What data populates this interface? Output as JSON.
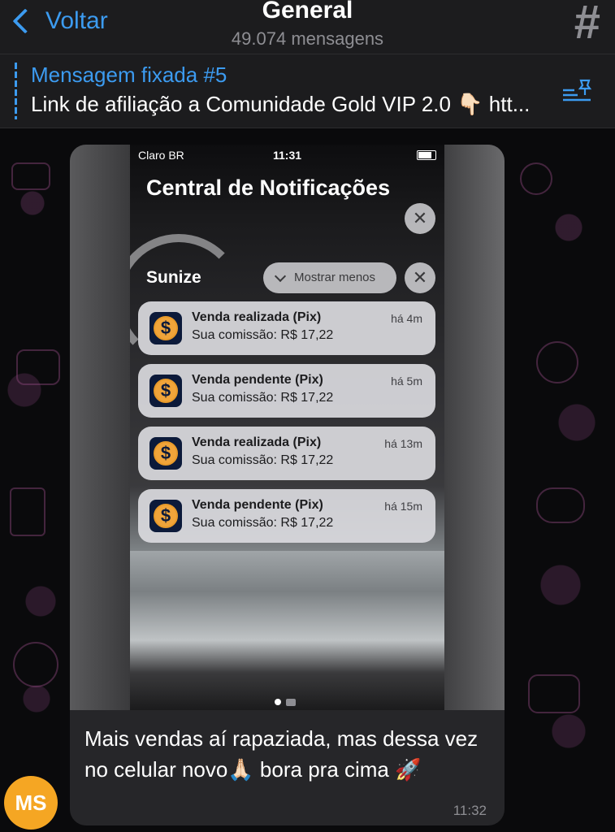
{
  "header": {
    "back_label": "Voltar",
    "title": "General",
    "subtitle": "49.074 mensagens",
    "hash_symbol": "#"
  },
  "pinned": {
    "label": "Mensagem fixada #5",
    "text": "Link de afiliação a Comunidade Gold VIP 2.0 👇🏻 htt..."
  },
  "media": {
    "status": {
      "carrier": "Claro BR",
      "time": "11:31"
    },
    "notification_center_title": "Central de Notificações",
    "app_group": "Sunize",
    "show_less_label": "Mostrar menos",
    "close_symbol": "✕",
    "notifications": [
      {
        "title": "Venda realizada (Pix)",
        "body": "Sua comissão: R$ 17,22",
        "time": "há 4m"
      },
      {
        "title": "Venda pendente (Pix)",
        "body": "Sua comissão: R$ 17,22",
        "time": "há 5m"
      },
      {
        "title": "Venda realizada (Pix)",
        "body": "Sua comissão: R$ 17,22",
        "time": "há 13m"
      },
      {
        "title": "Venda pendente (Pix)",
        "body": "Sua comissão: R$ 17,22",
        "time": "há 15m"
      }
    ],
    "coin_symbol": "$"
  },
  "message": {
    "text": "Mais vendas aí rapaziada, mas dessa vez no celular novo🙏🏻 bora pra cima 🚀",
    "time": "11:32",
    "avatar_initials": "MS"
  },
  "colors": {
    "accent": "#3c9bf0",
    "avatar": "#f5a623",
    "header_bg": "#1c1c1e"
  }
}
